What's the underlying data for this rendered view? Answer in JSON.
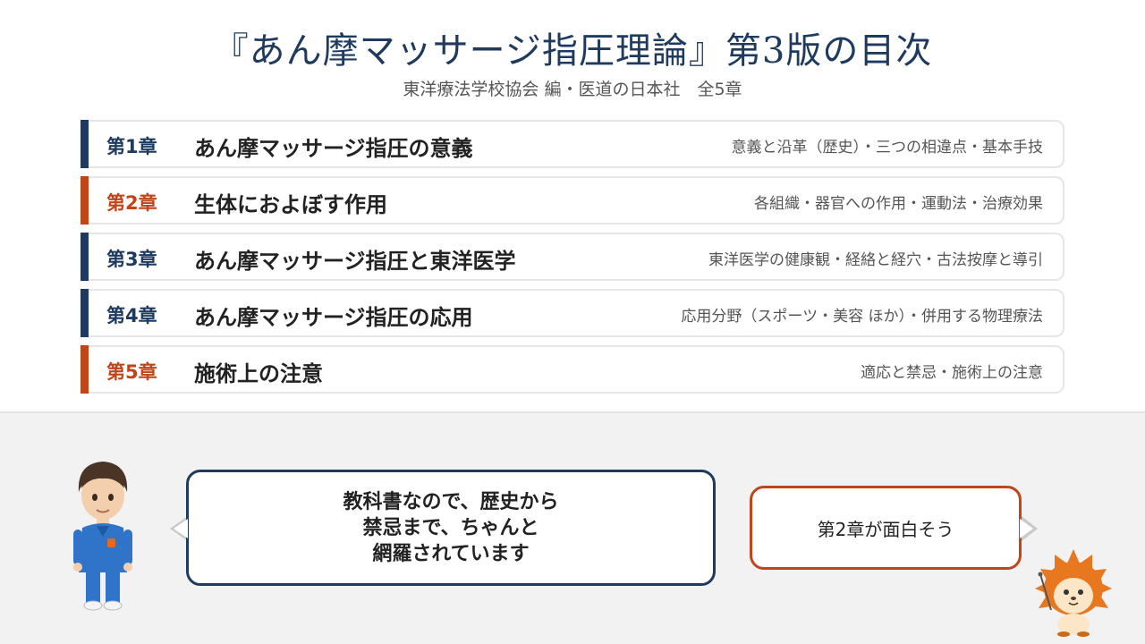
{
  "header": {
    "title": "『あん摩マッサージ指圧理論』第3版の目次",
    "subtitle": "東洋療法学校協会 編・医道の日本社　全5章"
  },
  "chapters": [
    {
      "num": "第1章",
      "name": "あん摩マッサージ指圧の意義",
      "desc": "意義と沿革（歴史）・三つの相違点・基本手技",
      "color": "#1f3a5f"
    },
    {
      "num": "第2章",
      "name": "生体におよぼす作用",
      "desc": "各組織・器官への作用・運動法・治療効果",
      "color": "#c0461a"
    },
    {
      "num": "第3章",
      "name": "あん摩マッサージ指圧と東洋医学",
      "desc": "東洋医学の健康観・経絡と経穴・古法按摩と導引",
      "color": "#1f3a5f"
    },
    {
      "num": "第4章",
      "name": "あん摩マッサージ指圧の応用",
      "desc": "応用分野（スポーツ・美容 ほか）・併用する物理療法",
      "color": "#1f3a5f"
    },
    {
      "num": "第5章",
      "name": "施術上の注意",
      "desc": "適応と禁忌・施術上の注意",
      "color": "#c0461a"
    }
  ],
  "dialogue": {
    "left_lines": [
      "教科書なので、歴史から",
      "禁忌まで、ちゃんと",
      "網羅されています"
    ],
    "right": "第2章が面白そう"
  },
  "colors": {
    "navy": "#1f3a5f",
    "orange": "#c0461a"
  },
  "icons": {
    "left_character": "doctor-character-icon",
    "right_character": "hedgehog-character-icon"
  }
}
